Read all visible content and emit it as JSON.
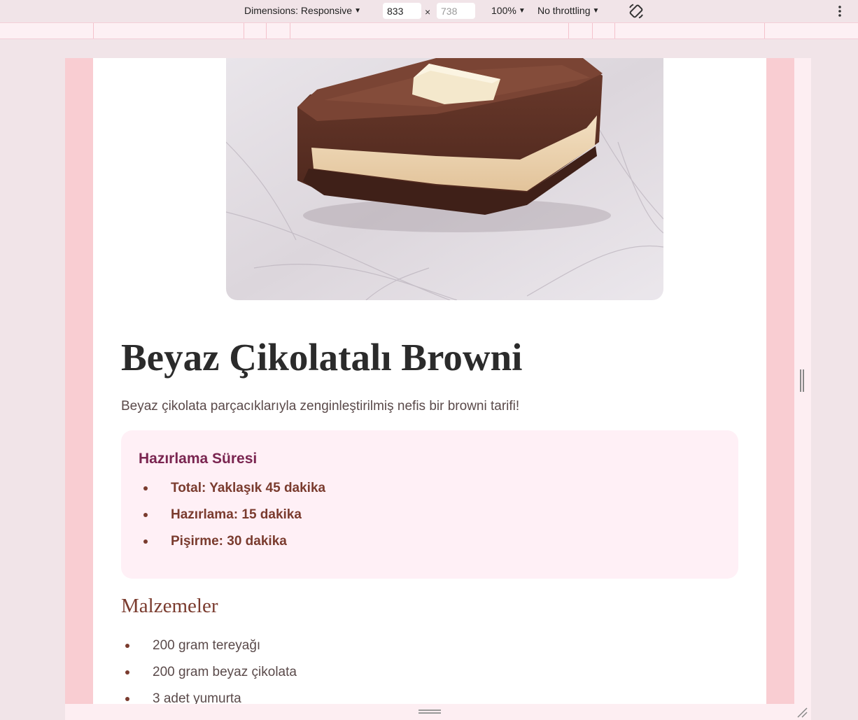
{
  "devtools": {
    "dimensions_label": "Dimensions: Responsive",
    "width_value": "833",
    "height_placeholder": "738",
    "times_sign": "×",
    "zoom_label": "100%",
    "throttling_label": "No throttling",
    "icons": [
      "chevron-down-icon",
      "rotate-icon",
      "more-vertical-icon",
      "resize-handle-icon"
    ]
  },
  "recipe": {
    "image_alt": "Beyaz çikolatalı browni dilimi",
    "title": "Beyaz Çikolatalı Browni",
    "subtitle": "Beyaz çikolata parçacıklarıyla zenginleştirilmiş nefis bir browni tarifi!",
    "prep": {
      "heading": "Hazırlama Süresi",
      "items": [
        "Total: Yaklaşık 45 dakika",
        "Hazırlama: 15 dakika",
        "Pişirme: 30 dakika"
      ]
    },
    "ingredients": {
      "heading": "Malzemeler",
      "items": [
        "200 gram tereyağı",
        "200 gram beyaz çikolata",
        "3 adet yumurta"
      ]
    }
  },
  "colors": {
    "page_bg": "#f1e4e8",
    "viewport_margin": "#f9cdd2",
    "prep_box_bg": "#fff0f6",
    "prep_heading": "#7a2550",
    "accent_brown": "#7a3b2e"
  }
}
